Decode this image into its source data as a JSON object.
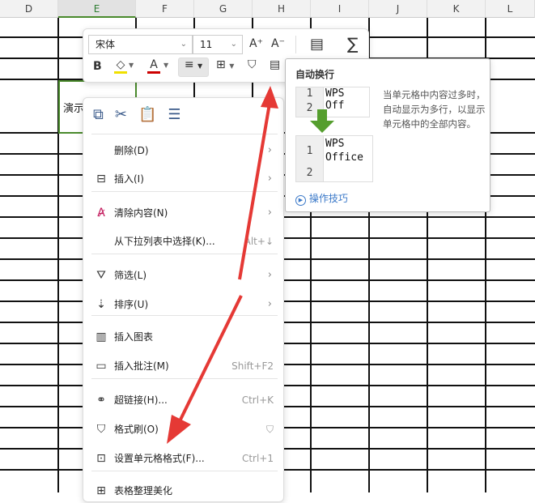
{
  "sheet": {
    "columns": [
      "D",
      "E",
      "F",
      "G",
      "H",
      "I",
      "J",
      "K",
      "L"
    ],
    "selected_column": "E",
    "selected_cell_text": "演示"
  },
  "toolbar": {
    "font_name": "宋体",
    "font_size": "11",
    "increase_font": "A⁺",
    "decrease_font": "A⁻",
    "bold": "B"
  },
  "tooltip": {
    "title": "自动换行",
    "before": {
      "row1": "1",
      "row1_text": "WPS Off",
      "row2": "2"
    },
    "after": {
      "row1": "1",
      "row1_text_line1": "WPS",
      "row1_text_line2": "Office",
      "row2": "2"
    },
    "description": "当单元格中内容过多时，自动显示为多行，以显示单元格中的全部内容。",
    "link": "操作技巧"
  },
  "context_menu": {
    "items": [
      {
        "label": "删除(D)",
        "shortcut": "",
        "submenu": true
      },
      {
        "label": "插入(I)",
        "shortcut": "",
        "submenu": true
      },
      {
        "label": "清除内容(N)",
        "shortcut": "",
        "submenu": true
      },
      {
        "label": "从下拉列表中选择(K)...",
        "shortcut": "Alt+↓",
        "submenu": false
      },
      {
        "label": "筛选(L)",
        "shortcut": "",
        "submenu": true
      },
      {
        "label": "排序(U)",
        "shortcut": "",
        "submenu": true
      },
      {
        "label": "插入图表",
        "shortcut": "",
        "submenu": false
      },
      {
        "label": "插入批注(M)",
        "shortcut": "Shift+F2",
        "submenu": false
      },
      {
        "label": "超链接(H)...",
        "shortcut": "Ctrl+K",
        "submenu": false
      },
      {
        "label": "格式刷(O)",
        "shortcut": "",
        "submenu": false
      },
      {
        "label": "设置单元格格式(F)...",
        "shortcut": "Ctrl+1",
        "submenu": false
      },
      {
        "label": "表格整理美化",
        "shortcut": "",
        "submenu": false
      }
    ]
  },
  "colors": {
    "accent_green": "#4a8a2c",
    "arrow_red": "#e53935",
    "link_blue": "#3a78c8"
  }
}
